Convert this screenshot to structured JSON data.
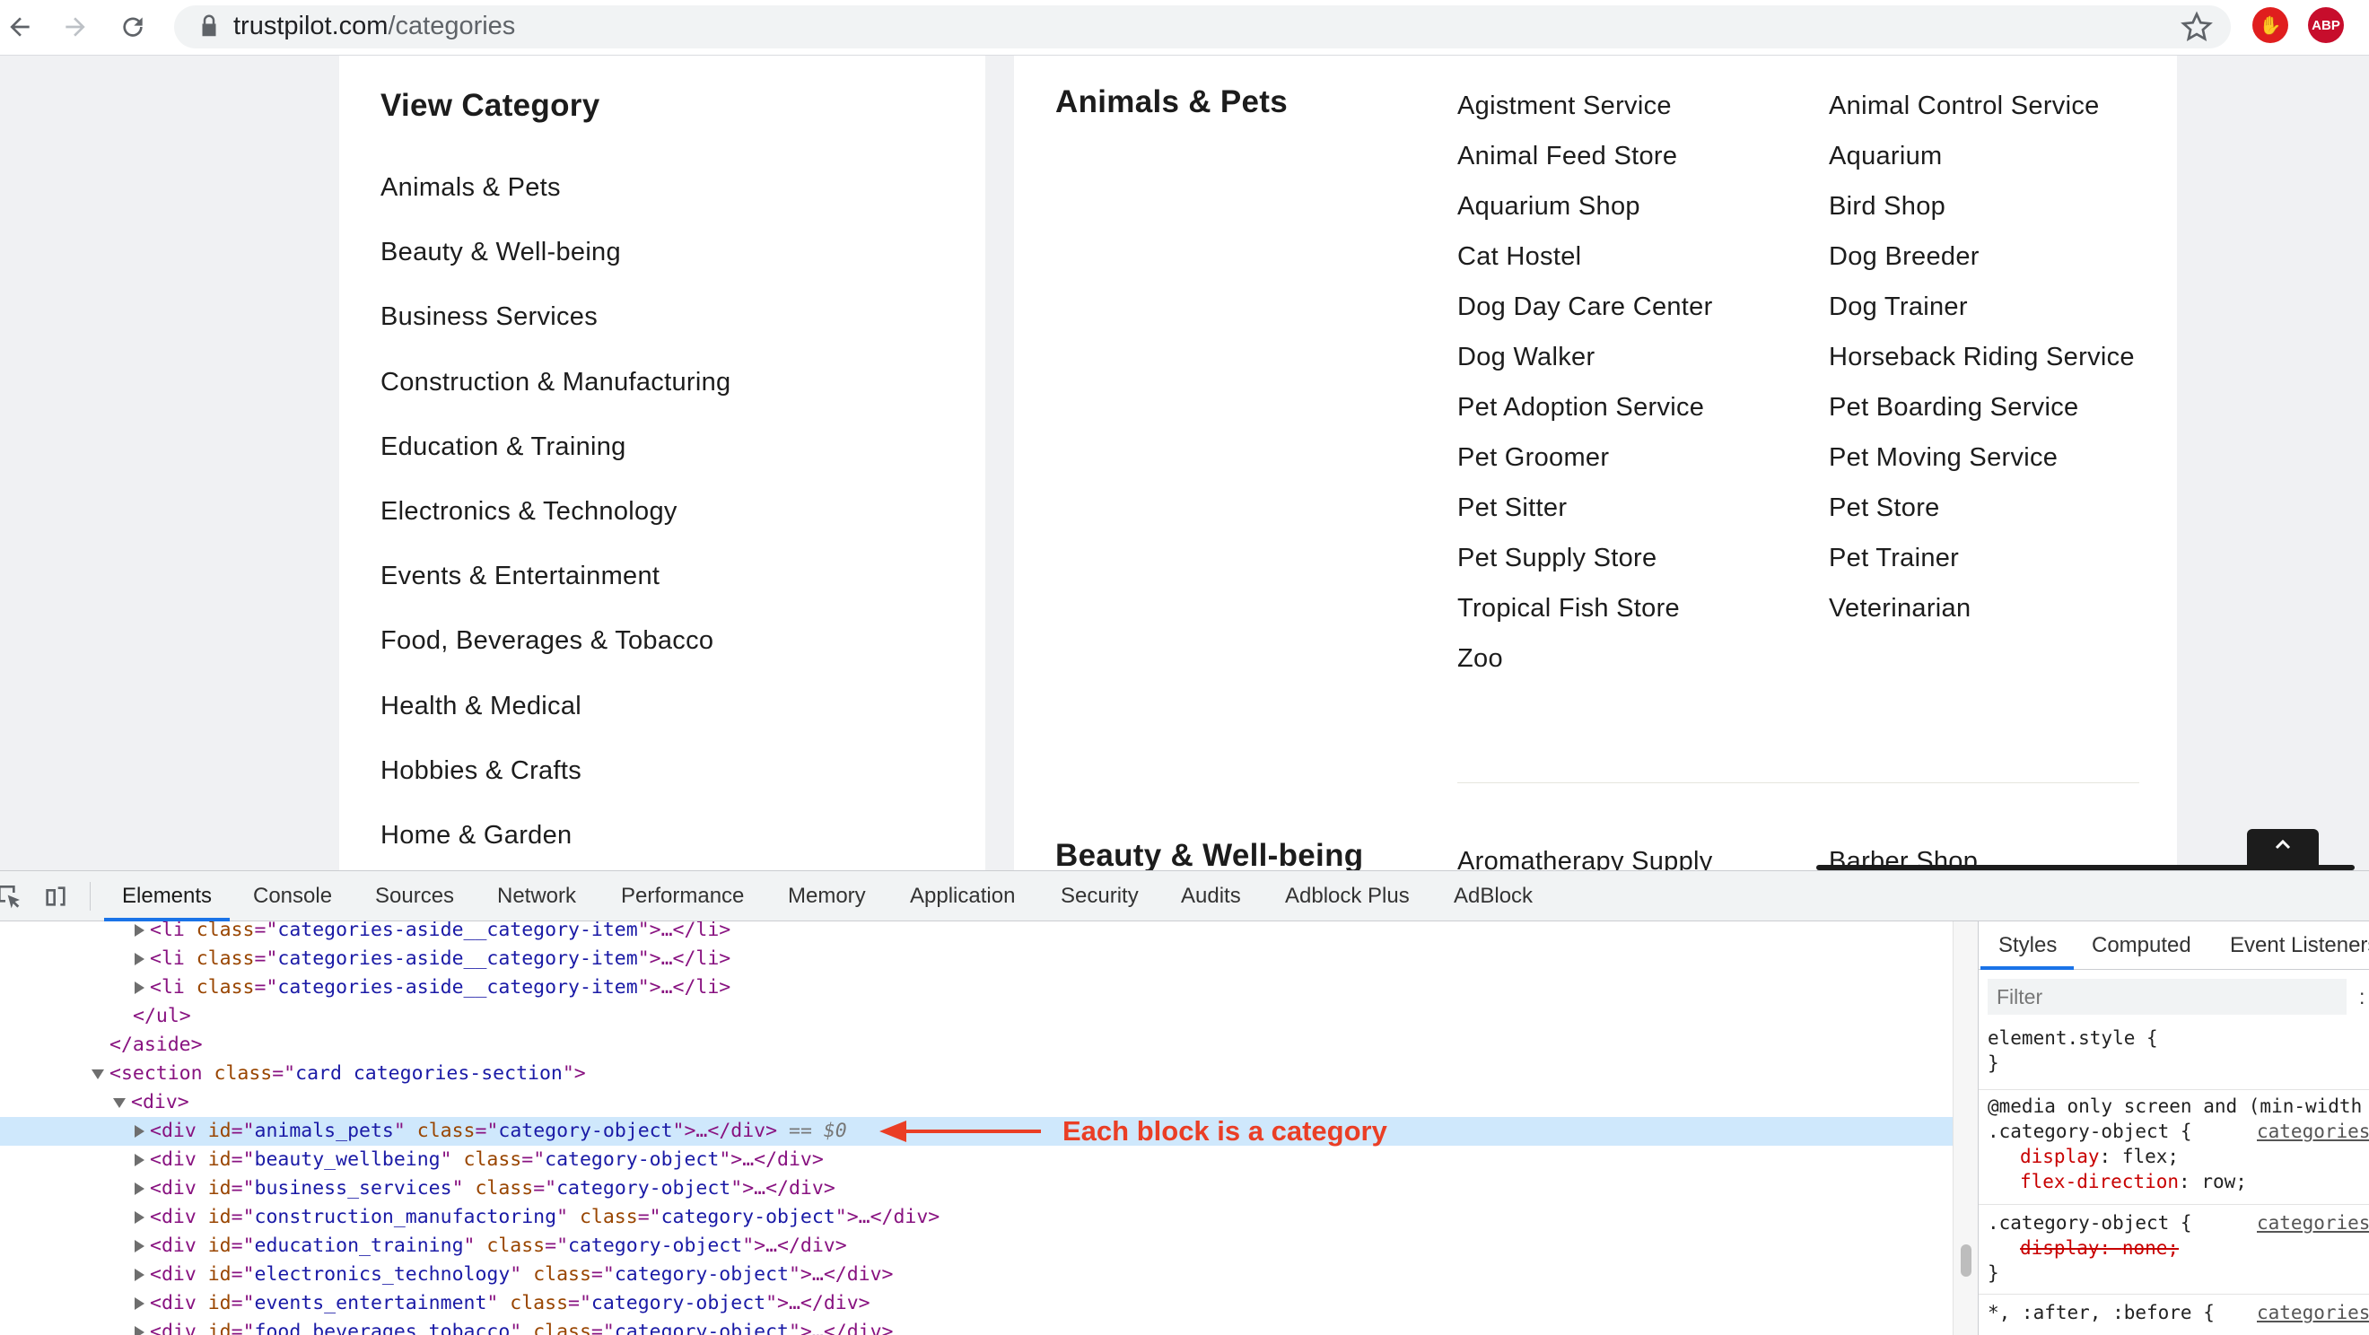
{
  "browser": {
    "url_domain": "trustpilot.com",
    "url_path": "/categories"
  },
  "aside": {
    "title": "View Category",
    "items": [
      "Animals & Pets",
      "Beauty & Well-being",
      "Business Services",
      "Construction & Manufacturing",
      "Education & Training",
      "Electronics & Technology",
      "Events & Entertainment",
      "Food, Beverages & Tobacco",
      "Health & Medical",
      "Hobbies & Crafts",
      "Home & Garden"
    ]
  },
  "section": {
    "category1": {
      "title": "Animals & Pets",
      "items": [
        "Agistment Service",
        "Animal Control Service",
        "Animal Feed Store",
        "Aquarium",
        "Aquarium Shop",
        "Bird Shop",
        "Cat Hostel",
        "Dog Breeder",
        "Dog Day Care Center",
        "Dog Trainer",
        "Dog Walker",
        "Horseback Riding Service",
        "Pet Adoption Service",
        "Pet Boarding Service",
        "Pet Groomer",
        "Pet Moving Service",
        "Pet Sitter",
        "Pet Store",
        "Pet Supply Store",
        "Pet Trainer",
        "Tropical Fish Store",
        "Veterinarian",
        "Zoo"
      ]
    },
    "category2": {
      "title": "Beauty & Well-being",
      "items": [
        "Aromatherapy Supply",
        "Barber Shop"
      ]
    }
  },
  "devtools": {
    "tabs": [
      "Elements",
      "Console",
      "Sources",
      "Network",
      "Performance",
      "Memory",
      "Application",
      "Security",
      "Audits",
      "Adblock Plus",
      "AdBlock"
    ],
    "dom": {
      "li_class": "categories-aside__category-item",
      "ul_close": "</ul>",
      "aside_close": "</aside>",
      "section_class": "card categories-section",
      "div_open": "<div>",
      "object_class": "category-object",
      "selected_suffix": "== $0",
      "ids": [
        "animals_pets",
        "beauty_wellbeing",
        "business_services",
        "construction_manufactoring",
        "education_training",
        "electronics_technology",
        "events_entertainment",
        "food_beverages_tobacco"
      ]
    },
    "annotation": "Each block is a category",
    "styles": {
      "tabs": [
        "Styles",
        "Computed",
        "Event Listeners"
      ],
      "filter_placeholder": "Filter",
      "filter_colon": ":",
      "element_style": "element.style {",
      "close_brace": "}",
      "media": "@media only screen and (min-width",
      "selector": ".category-object {",
      "source": "categories",
      "display": "display",
      "flex": "flex;",
      "flex_direction": "flex-direction",
      "row": "row;",
      "none": "none;",
      "after_before": "*, :after, :before {"
    }
  },
  "colors": {
    "annotation": "#ea3e25",
    "selected_row": "#cfe8fc",
    "accent": "#1a73e8"
  }
}
